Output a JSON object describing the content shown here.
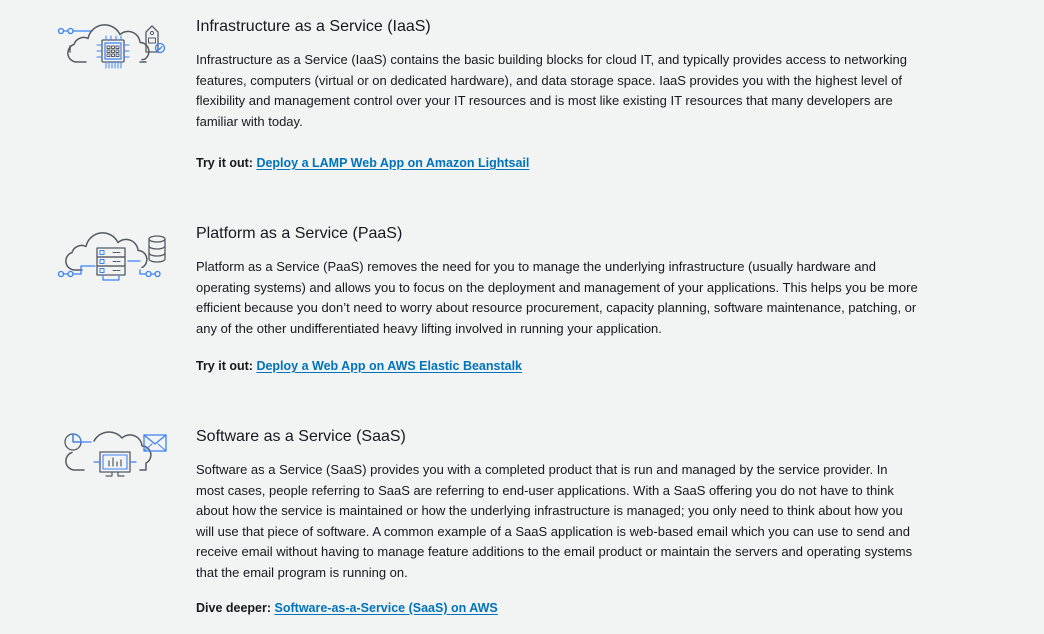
{
  "sections": [
    {
      "icon": "cloud-infrastructure-icon",
      "title": "Infrastructure as a Service (IaaS)",
      "description": "Infrastructure as a Service (IaaS) contains the basic building blocks for cloud IT, and typically provides access to networking features, computers (virtual or on dedicated hardware), and data storage space. IaaS provides you with the highest level of flexibility and management control over your IT resources and is most like existing IT resources that many developers are familiar with today.",
      "cta_label": "Try it out:",
      "link_text": "Deploy a LAMP Web App on Amazon Lightsail"
    },
    {
      "icon": "cloud-platform-icon",
      "title": "Platform as a Service (PaaS)",
      "description": "Platform as a Service (PaaS) removes the need for you to manage the underlying infrastructure (usually hardware and operating systems) and allows you to focus on the deployment and management of your applications. This helps you be more efficient because you don’t need to worry about resource procurement, capacity planning, software maintenance, patching, or any of the other undifferentiated heavy lifting involved in running your application.",
      "cta_label": "Try it out:",
      "link_text": "Deploy a Web App on AWS Elastic Beanstalk"
    },
    {
      "icon": "cloud-software-icon",
      "title": "Software as a Service (SaaS)",
      "description": "Software as a Service (SaaS) provides you with a completed product that is run and managed by the service provider. In most cases, people referring to SaaS are referring to end-user applications. With a SaaS offering you do not have to think about how the service is maintained or how the underlying infrastructure is managed; you only need to think about how you will use that piece of software. A common example of a SaaS application is web-based email which you can use to send and receive email without having to manage feature additions to the email product or maintain the servers and operating systems that the email program is running on.",
      "cta_label": "Dive deeper:",
      "link_text": "Software-as-a-Service (SaaS) on AWS"
    }
  ],
  "colors": {
    "background": "#f2f3f3",
    "text": "#16191f",
    "link": "#0073bb",
    "icon_gray": "#545b64",
    "icon_blue": "#3b82f6"
  }
}
